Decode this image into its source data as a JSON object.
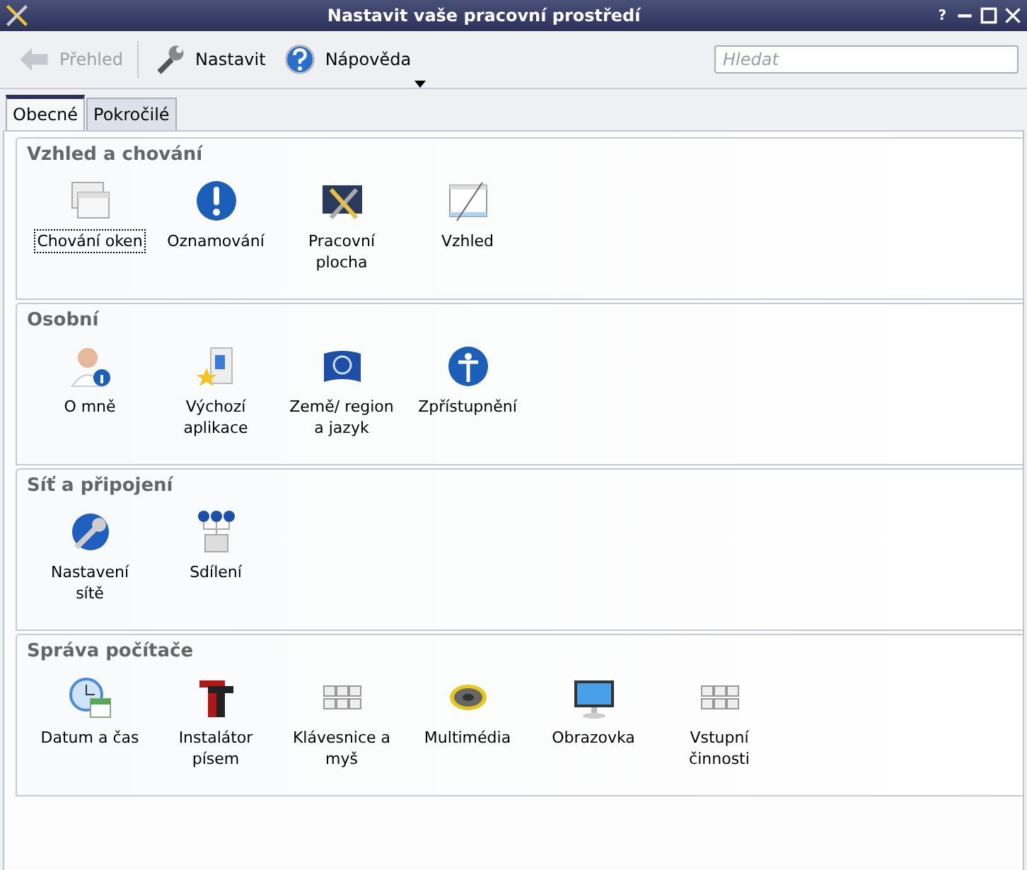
{
  "window": {
    "title": "Nastavit vaše pracovní prostředí",
    "buttons": [
      "?"
    ]
  },
  "toolbar": {
    "items": [
      {
        "label": "Přehled",
        "disabled": true
      },
      {
        "label": "Nastavit",
        "disabled": false
      },
      {
        "label": "Nápověda",
        "disabled": false,
        "dropdown": true
      }
    ],
    "search": {
      "placeholder": "Hledat"
    }
  },
  "tabs": [
    {
      "label": "Obecné",
      "selected": true
    },
    {
      "label": "Pokročilé",
      "selected": false
    }
  ],
  "sections": [
    {
      "title": "Vzhled a chování",
      "items": [
        {
          "label": "Chování oken",
          "focused": true
        },
        {
          "label": "Oznamování",
          "focused": false
        },
        {
          "label": "Pracovní plocha",
          "focused": false
        },
        {
          "label": "Vzhled",
          "focused": false
        }
      ]
    },
    {
      "title": "Osobní",
      "items": [
        {
          "label": "O mně",
          "focused": false
        },
        {
          "label": "Výchozí aplikace",
          "focused": false
        },
        {
          "label": "Země/ region a jazyk",
          "focused": false
        },
        {
          "label": "Zpřístupnění",
          "focused": false
        }
      ]
    },
    {
      "title": "Síť a připojení",
      "items": [
        {
          "label": "Nastavení sítě",
          "focused": false
        },
        {
          "label": "Sdílení",
          "focused": false
        }
      ]
    },
    {
      "title": "Správa počítače",
      "items": [
        {
          "label": "Datum a čas",
          "focused": false
        },
        {
          "label": "Instalátor písem",
          "focused": false
        },
        {
          "label": "Klávesnice a myš",
          "focused": false
        },
        {
          "label": "Multimédia",
          "focused": false
        },
        {
          "label": "Obrazovka",
          "focused": false
        },
        {
          "label": "Vstupní činnosti",
          "focused": false
        }
      ]
    }
  ]
}
